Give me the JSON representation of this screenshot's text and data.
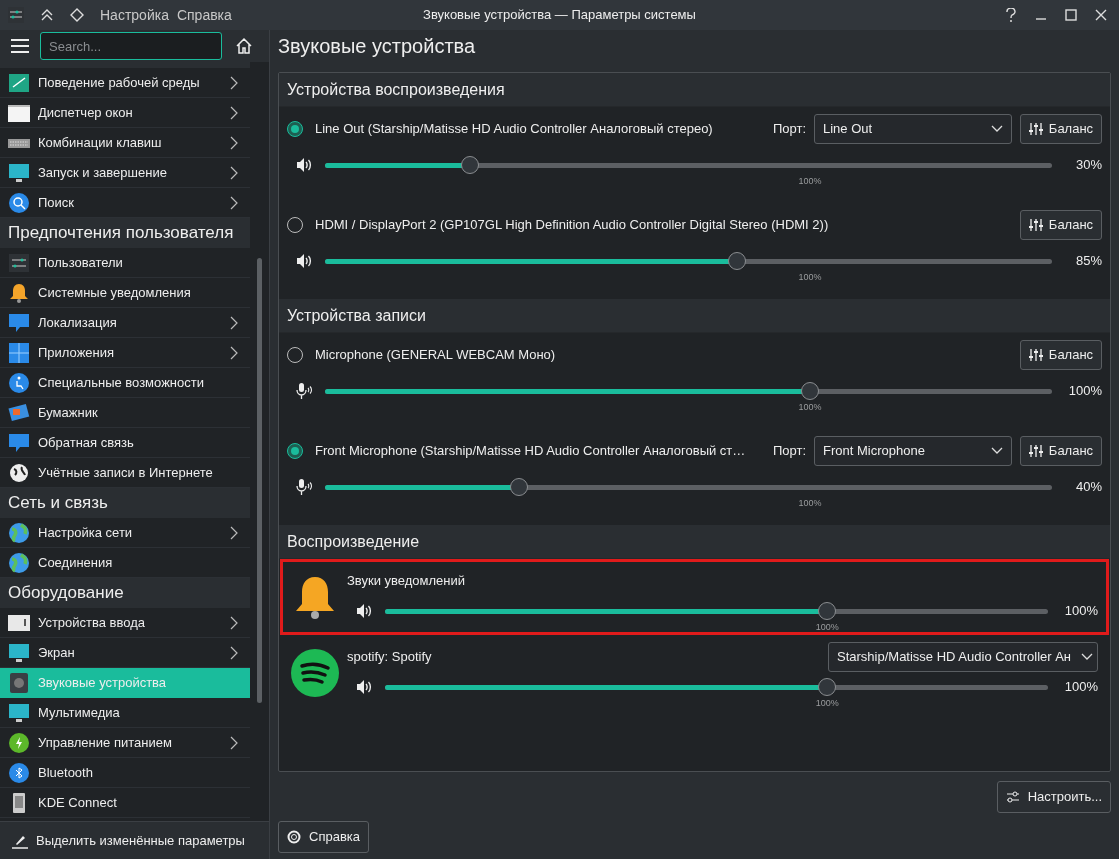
{
  "window": {
    "title": "Звуковые устройства — Параметры системы",
    "menu": [
      "Настройка",
      "Справка"
    ]
  },
  "search": {
    "placeholder": "Search..."
  },
  "sidebar": {
    "groups": [
      {
        "items": [
          {
            "label": "Поведение рабочей среды",
            "has_children": true,
            "selected": false
          },
          {
            "label": "Диспетчер окон",
            "has_children": true,
            "selected": false
          },
          {
            "label": "Комбинации клавиш",
            "has_children": true,
            "selected": false
          },
          {
            "label": "Запуск и завершение",
            "has_children": true,
            "selected": false
          },
          {
            "label": "Поиск",
            "has_children": true,
            "selected": false
          }
        ]
      },
      {
        "title": "Предпочтения пользователя",
        "items": [
          {
            "label": "Пользователи",
            "has_children": false,
            "selected": false
          },
          {
            "label": "Системные уведомления",
            "has_children": false,
            "selected": false
          },
          {
            "label": "Локализация",
            "has_children": true,
            "selected": false
          },
          {
            "label": "Приложения",
            "has_children": true,
            "selected": false
          },
          {
            "label": "Специальные возможности",
            "has_children": false,
            "selected": false
          },
          {
            "label": "Бумажник",
            "has_children": false,
            "selected": false
          },
          {
            "label": "Обратная связь",
            "has_children": false,
            "selected": false
          },
          {
            "label": "Учётные записи в Интернете",
            "has_children": false,
            "selected": false
          }
        ]
      },
      {
        "title": "Сеть и связь",
        "items": [
          {
            "label": "Настройка сети",
            "has_children": true,
            "selected": false
          },
          {
            "label": "Соединения",
            "has_children": false,
            "selected": false
          }
        ]
      },
      {
        "title": "Оборудование",
        "items": [
          {
            "label": "Устройства ввода",
            "has_children": true,
            "selected": false
          },
          {
            "label": "Экран",
            "has_children": true,
            "selected": false
          },
          {
            "label": "Звуковые устройства",
            "has_children": false,
            "selected": true
          },
          {
            "label": "Мультимедиа",
            "has_children": false,
            "selected": false
          },
          {
            "label": "Управление питанием",
            "has_children": true,
            "selected": false
          },
          {
            "label": "Bluetooth",
            "has_children": false,
            "selected": false
          },
          {
            "label": "KDE Connect",
            "has_children": false,
            "selected": false
          }
        ]
      }
    ],
    "footer": "Выделить изменённые параметры"
  },
  "page_title": "Звуковые устройства",
  "sections": [
    {
      "title": "Устройства воспроизведения",
      "kind": "output",
      "rows": [
        {
          "kind": "device",
          "name": "Line Out (Starship/Matisse HD Audio Controller Аналоговый стерео)",
          "selected": true,
          "port_label": "Порт:",
          "port": "Line Out",
          "balance": "Баланс",
          "level": 0.2,
          "reading": "30%",
          "scale_mark": "100%"
        },
        {
          "kind": "device",
          "name": "HDMI / DisplayPort 2 (GP107GL High Definition Audio Controller Digital Stereo (HDMI 2))",
          "selected": false,
          "balance": "Баланс",
          "level": 0.567,
          "reading": "85%",
          "scale_mark": "100%"
        }
      ]
    },
    {
      "title": "Устройства записи",
      "kind": "input",
      "rows": [
        {
          "kind": "device",
          "name": "Microphone (GENERAL WEBCAM Моно)",
          "selected": false,
          "balance": "Баланс",
          "level": 0.667,
          "reading": "100%",
          "scale_mark": "100%"
        },
        {
          "kind": "device",
          "name": "Front Microphone (Starship/Matisse HD Audio Controller Аналоговый ст…",
          "selected": true,
          "port_label": "Порт:",
          "port": "Front Microphone",
          "balance": "Баланс",
          "level": 0.267,
          "reading": "40%",
          "scale_mark": "100%"
        }
      ]
    },
    {
      "title": "Воспроизведение",
      "kind": "output",
      "rows": [
        {
          "kind": "stream",
          "name": "Звуки уведомлений",
          "highlighted": true,
          "level": 0.667,
          "reading": "100%",
          "scale_mark": "100%"
        },
        {
          "kind": "stream",
          "name": "spotify: Spotify",
          "highlighted": false,
          "device": "Starship/Matisse HD Audio Controller Ан",
          "level": 0.667,
          "reading": "100%",
          "scale_mark": "100%"
        }
      ]
    }
  ],
  "buttons": {
    "configure": "Настроить...",
    "help": "Справка"
  }
}
